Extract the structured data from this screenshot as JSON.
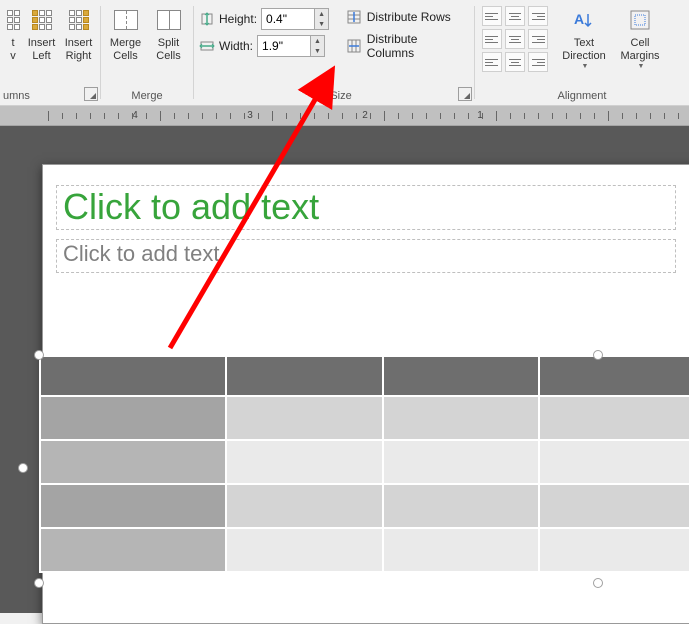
{
  "ribbon": {
    "insert": {
      "group_label": "umns",
      "insert_v": "t\nv",
      "insert_left": "Insert\nLeft",
      "insert_right": "Insert\nRight"
    },
    "merge": {
      "group_label": "Merge",
      "merge_cells": "Merge\nCells",
      "split_cells": "Split\nCells"
    },
    "cellsize": {
      "group_label": "ell Size",
      "height_label": "Height:",
      "height_value": "0.4\"",
      "width_label": "Width:",
      "width_value": "1.9\"",
      "dist_rows": "Distribute Rows",
      "dist_cols": "Distribute Columns"
    },
    "alignment": {
      "group_label": "Alignment",
      "text_direction": "Text\nDirection",
      "cell_margins": "Cell\nMargins"
    }
  },
  "ruler": {
    "labels": [
      "4",
      "3",
      "2",
      "1"
    ]
  },
  "slide": {
    "title_placeholder": "Click to add text",
    "subtitle_placeholder": "Click to add text"
  },
  "annotation": {
    "color": "#ff0000"
  }
}
